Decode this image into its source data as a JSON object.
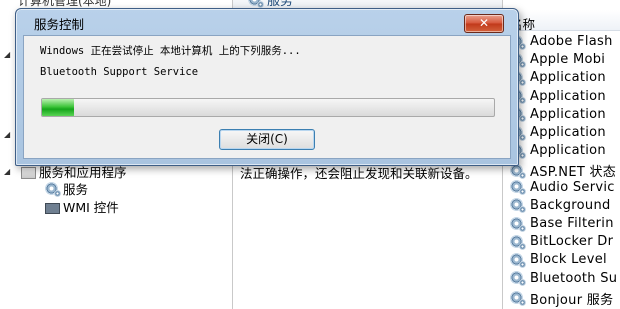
{
  "left_tree": {
    "top_item": "计算机管理(本地)",
    "services_apps": "服务和应用程序",
    "services": "服务",
    "wmi": "WMI 控件"
  },
  "middle": {
    "header": "服务",
    "description": "法正确操作，还会阻止发现和关联新设备。"
  },
  "right": {
    "column_header": "名称",
    "services": [
      "Adobe Flash",
      "Apple Mobi",
      "Application",
      "Application",
      "Application",
      "Application",
      "Application",
      "ASP.NET 状态",
      "Audio Servic",
      "Background",
      "Base Filterin",
      "BitLocker Dr",
      "Block Level",
      "Bluetooth Su",
      "Bonjour 服务"
    ]
  },
  "dialog": {
    "title": "服务控制",
    "close_x": "✕",
    "message": "Windows 正在尝试停止 本地计算机 上的下列服务...",
    "service_name": "Bluetooth Support Service",
    "progress_percent": 7,
    "button_label": "关闭(C)"
  },
  "colors": {
    "progress_green": "#16a61b",
    "title_bar": "#b9d1ea",
    "close_red": "#c1391a"
  },
  "icons": {
    "service": "gear-icon",
    "services_apps": "application-icon",
    "wmi": "wmi-icon"
  }
}
